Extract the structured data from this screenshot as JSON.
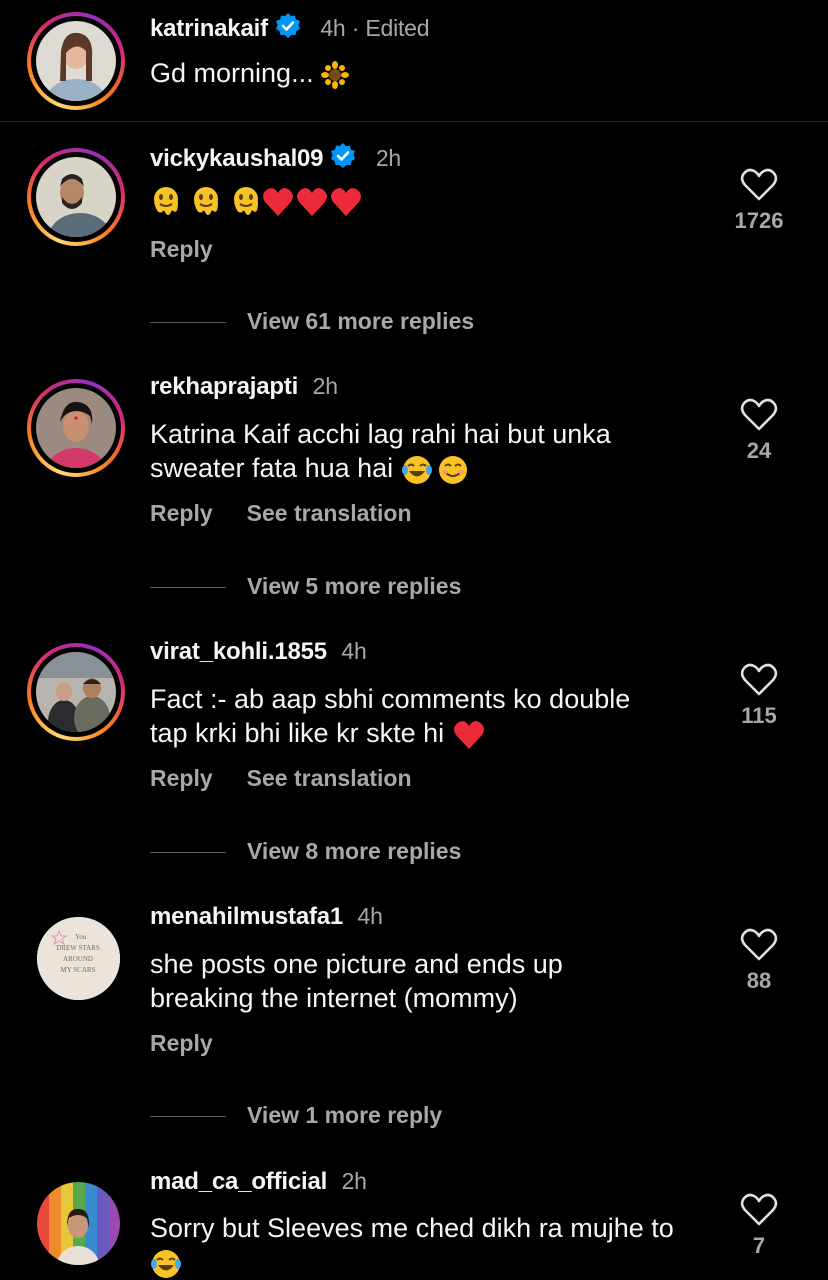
{
  "caption": {
    "username": "katrinakaif",
    "time": "4h · Edited",
    "text": "Gd morning..."
  },
  "comments": [
    {
      "username": "vickykaushal09",
      "time": "2h",
      "text": "",
      "reply": "Reply",
      "likes": "1726",
      "view_replies": "View 61 more replies"
    },
    {
      "username": "rekhaprajapti",
      "time": "2h",
      "text_line1": "Katrina Kaif acchi lag rahi hai but unka",
      "text_line2": "sweater fata hua hai",
      "reply": "Reply",
      "translate": "See translation",
      "likes": "24",
      "view_replies": "View 5 more replies"
    },
    {
      "username": "virat_kohli.1855",
      "time": "4h",
      "text_line1": "Fact :- ab aap sbhi comments ko double",
      "text_line2": "tap krki bhi like kr skte hi",
      "reply": "Reply",
      "translate": "See translation",
      "likes": "115",
      "view_replies": "View 8 more replies"
    },
    {
      "username": "menahilmustafa1",
      "time": "4h",
      "text_line1": "she posts one picture and ends up",
      "text_line2": "breaking the internet (mommy)",
      "reply": "Reply",
      "likes": "88",
      "view_replies": "View 1 more reply",
      "avatar_lines": [
        "You",
        "DREW STARS",
        "AROUND",
        "MY SCARS"
      ]
    },
    {
      "username": "mad_ca_official",
      "time": "2h",
      "text_line1": "Sorry but Sleeves me ched dikh ra mujhe to",
      "likes": "7"
    }
  ],
  "colors": {
    "background": "#000000",
    "text": "#f5f5f5",
    "muted": "#a8a8a8",
    "verified": "#0095f6",
    "heart": "#ed2a3a"
  },
  "icons": [
    "verified-badge-icon",
    "heart-outline-icon",
    "sunflower-emoji",
    "melting-face-emoji",
    "red-heart-emoji",
    "joy-emoji",
    "smiling-face-emoji"
  ]
}
